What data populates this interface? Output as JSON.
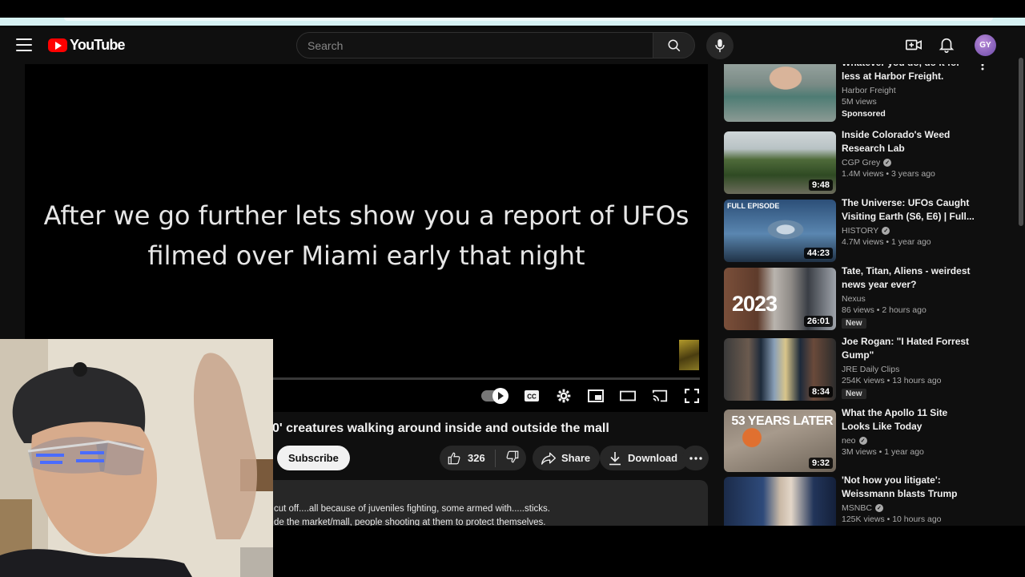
{
  "masthead": {
    "logo_text": "YouTube",
    "search_placeholder": "Search",
    "avatar_initials": "GY"
  },
  "player": {
    "caption_line1": "After we go further lets show you a report of UFOs",
    "caption_line2": "filmed over Miami early that night"
  },
  "video": {
    "title": "0' creatures walking around inside and outside the mall",
    "subscribe_label": "Subscribe",
    "like_count": "326",
    "share_label": "Share",
    "download_label": "Download",
    "description_line1": "cut off....all because of juveniles fighting, some armed with.....sticks.",
    "description_line2": "de the market/mall, people shooting at them to protect themselves."
  },
  "recommendations": [
    {
      "title": "Whatever you do, do it for less at Harbor Freight.",
      "channel": "Harbor Freight",
      "meta": "5M views",
      "badge": "Sponsored",
      "duration": "",
      "verified": false
    },
    {
      "title": "Inside Colorado's Weed Research Lab",
      "channel": "CGP Grey",
      "meta": "1.4M views • 3 years ago",
      "badge": "",
      "duration": "9:48",
      "verified": true
    },
    {
      "title": "The Universe: UFOs Caught Visiting Earth (S6, E6) | Full...",
      "channel": "HISTORY",
      "meta": "4.7M views • 1 year ago",
      "badge": "",
      "duration": "44:23",
      "verified": true,
      "thumb_text": "FULL EPISODE"
    },
    {
      "title": "Tate, Titan, Aliens - weirdest news year ever?",
      "channel": "Nexus",
      "meta": "86 views • 2 hours ago",
      "badge": "New",
      "duration": "26:01",
      "verified": false,
      "thumb_text": "2023"
    },
    {
      "title": "Joe Rogan: \"I Hated Forrest Gump\"",
      "channel": "JRE Daily Clips",
      "meta": "254K views • 13 hours ago",
      "badge": "New",
      "duration": "8:34",
      "verified": false
    },
    {
      "title": "What the Apollo 11 Site Looks Like Today",
      "channel": "neo",
      "meta": "3M views • 1 year ago",
      "badge": "",
      "duration": "9:32",
      "verified": true,
      "thumb_text": "53 YEARS LATER"
    },
    {
      "title": "'Not how you litigate': Weissmann blasts Trump for...",
      "channel": "MSNBC",
      "meta": "125K views • 10 hours ago",
      "badge": "",
      "duration": "",
      "verified": true
    }
  ],
  "colors": {
    "background": "#0f0f0f",
    "accent": "#ff0000",
    "pill": "#272727"
  }
}
